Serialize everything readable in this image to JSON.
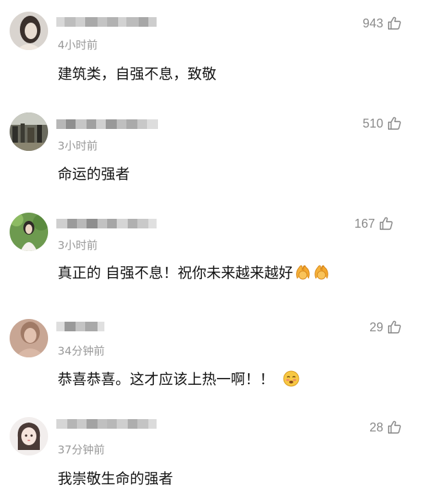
{
  "comments": [
    {
      "username": "",
      "time": "4小时前",
      "likes": "943",
      "text": "建筑类，自强不息，致敬",
      "avatar": "avatar-1",
      "emoji": []
    },
    {
      "username": "",
      "time": "3小时前",
      "likes": "510",
      "text": "命运的强者",
      "avatar": "avatar-2",
      "emoji": []
    },
    {
      "username": "",
      "time": "3小时前",
      "likes": "167",
      "text": "真正的 自强不息！祝你未来越来越好",
      "avatar": "avatar-3",
      "emoji": [
        "clapping-emoji",
        "clapping-emoji"
      ]
    },
    {
      "username": "",
      "time": "34分钟前",
      "likes": "29",
      "text": "恭喜恭喜。这才应该上热一啊！！",
      "avatar": "avatar-4",
      "emoji": [
        "blushing-emoji"
      ]
    },
    {
      "username": "",
      "time": "37分钟前",
      "likes": "28",
      "text": "我崇敬生命的强者",
      "avatar": "avatar-5",
      "emoji": []
    }
  ],
  "icons": {
    "like": "thumbs-up-icon"
  },
  "colors": {
    "time": "#9a9a9a",
    "likes": "#8c8c8c",
    "text": "#161616"
  }
}
